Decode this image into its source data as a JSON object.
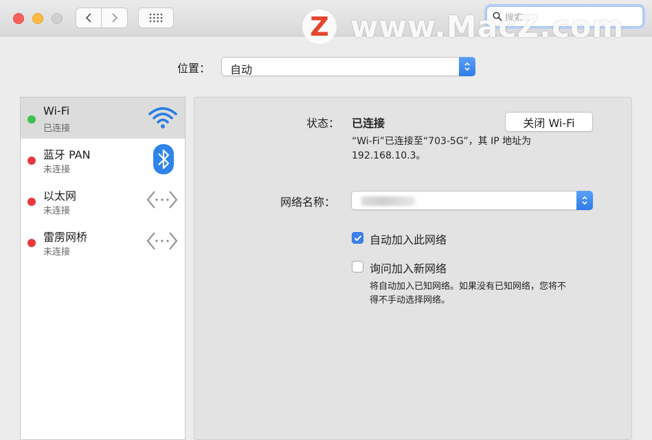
{
  "titlebar": {
    "search_placeholder": "搜索",
    "watermark_badge": "Z",
    "watermark_text": "www.MacZ.com"
  },
  "location": {
    "label": "位置：",
    "value": "自动"
  },
  "services": [
    {
      "name": "Wi-Fi",
      "status": "已连接",
      "dot": "#3fc14f",
      "icon": "wifi-icon"
    },
    {
      "name": "蓝牙 PAN",
      "status": "未连接",
      "dot": "#e8383d",
      "icon": "bluetooth-icon"
    },
    {
      "name": "以太网",
      "status": "未连接",
      "dot": "#e8383d",
      "icon": "ethernet-icon"
    },
    {
      "name": "雷雳网桥",
      "status": "未连接",
      "dot": "#e8383d",
      "icon": "thunderbolt-bridge-icon"
    }
  ],
  "detail": {
    "status_label": "状态：",
    "status_value": "已连接",
    "toggle_button": "关闭 Wi-Fi",
    "status_desc_line1": "“Wi-Fi”已连接至“703-5G”，其 IP 地址为",
    "status_desc_line2": "192.168.10.3。",
    "network_name_label": "网络名称：",
    "auto_join_label": "自动加入此网络",
    "auto_join_checked": true,
    "ask_join_label": "询问加入新网络",
    "ask_join_checked": false,
    "ask_join_desc_line1": "将自动加入已知网络。如果没有已知网络，您将不",
    "ask_join_desc_line2": "得不手动选择网络。"
  },
  "colors": {
    "accent": "#3b82f0",
    "connected": "#3fc14f",
    "disconnected": "#e8383d"
  }
}
